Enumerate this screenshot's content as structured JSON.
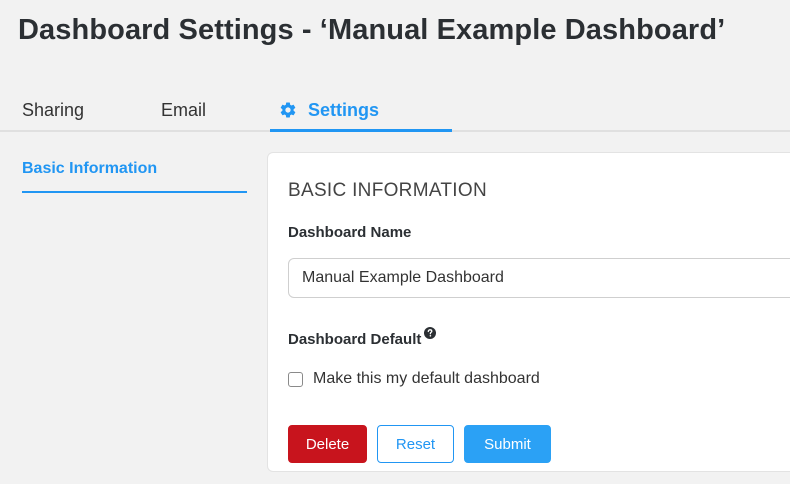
{
  "page": {
    "title": "Dashboard Settings - ‘Manual Example Dashboard’"
  },
  "tabs": [
    {
      "label": "Sharing",
      "active": false
    },
    {
      "label": "Email",
      "active": false
    },
    {
      "label": "Settings",
      "active": true,
      "icon": "gear-icon"
    }
  ],
  "sidenav": {
    "items": [
      {
        "label": "Basic Information",
        "active": true
      }
    ]
  },
  "panel": {
    "heading": "BASIC INFORMATION",
    "name_label": "Dashboard Name",
    "name_value": "Manual Example Dashboard",
    "default_label": "Dashboard Default",
    "default_help_icon": "question-circle-icon",
    "default_checkbox_label": "Make this my default dashboard",
    "default_checked": false,
    "buttons": {
      "delete": "Delete",
      "reset": "Reset",
      "submit": "Submit"
    }
  },
  "colors": {
    "accent": "#2196f3",
    "danger": "#c8141d",
    "submit": "#2ba1f5",
    "background": "#f2f2f2"
  }
}
